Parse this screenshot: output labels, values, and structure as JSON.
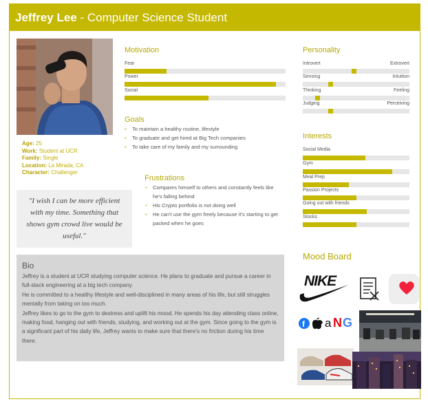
{
  "header": {
    "name": "Jeffrey Lee",
    "separator": " - ",
    "role": "Computer Science Student"
  },
  "demographics": [
    {
      "key": "Age:",
      "value": "25"
    },
    {
      "key": "Work:",
      "value": "Student at UCR"
    },
    {
      "key": "Family:",
      "value": "Single"
    },
    {
      "key": "Location:",
      "value": "La Mirada, CA"
    },
    {
      "key": "Character:",
      "value": "Challenger"
    }
  ],
  "quote": "\"I wish I can be more efficient with my time. Something that shows gym crowd live would be useful.\"",
  "motivation": {
    "title": "Motivation",
    "items": [
      {
        "label": "Fear",
        "value": 0.26
      },
      {
        "label": "Power",
        "value": 0.94
      },
      {
        "label": "Social",
        "value": 0.52
      }
    ]
  },
  "goals": {
    "title": "Goals",
    "items": [
      "To maintain a healthy routine, lifestyle",
      "To graduate and get hired at Big Tech companies",
      "To take care of my family and my surrounding"
    ]
  },
  "frustrations": {
    "title": "Frustrations",
    "items": [
      "Compares himself to others and constantly feels like he's falling behind",
      "His Crypto portfolio is not doing well",
      "He can't use the gym freely because it's starting to get packed when he goes"
    ]
  },
  "personality": {
    "title": "Personality",
    "items": [
      {
        "left": "Introvert",
        "right": "Extrovert",
        "value": 0.48
      },
      {
        "left": "Sensing",
        "right": "Intuition",
        "value": 0.25
      },
      {
        "left": "Thinking",
        "right": "Feeling",
        "value": 0.12
      },
      {
        "left": "Judging",
        "right": "Perceiving",
        "value": 0.25
      }
    ]
  },
  "interests": {
    "title": "Interests",
    "items": [
      {
        "label": "Social Media",
        "value": 0.59
      },
      {
        "label": "Gym",
        "value": 0.84
      },
      {
        "label": "Meal Prep",
        "value": 0.43
      },
      {
        "label": "Passion Projects",
        "value": 0.5
      },
      {
        "label": "Going out with friends",
        "value": 0.6
      },
      {
        "label": "Stocks",
        "value": 0.5
      }
    ]
  },
  "bio": {
    "title": "Bio",
    "paragraphs": [
      "Jeffrey is a student at UCR studying computer science. He plans to graduate and pursue a career in full-stack engineering at a big tech company.",
      "He is committed to a healthy lifestyle and well-disciplined in many areas of his life, but still struggles mentally from taking on too much.",
      "Jeffrey likes to go to the gym to destress and uplift his mood. He spends his day attending class online, making food, hanging out with friends, studying, and working out at the gym. Since going to the gym is a significant part of his daily life, Jeffrey wants to make sure that there's no friction during his time there."
    ]
  },
  "mood_board": {
    "title": "Mood Board",
    "nike_text": "NIKE",
    "brand_letters": [
      "a",
      "N",
      "G"
    ]
  },
  "colors": {
    "accent": "#c5b800",
    "track": "#e6e6e6",
    "bio_bg": "#d6d6d6",
    "quote_bg": "#efefef"
  }
}
